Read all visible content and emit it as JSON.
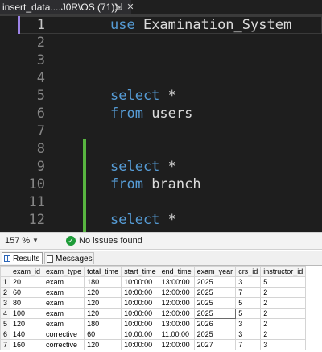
{
  "tab": {
    "title": "insert_data....J0R\\OS (71))",
    "pin_glyph": "⇲",
    "close_glyph": "✕"
  },
  "editor": {
    "lines": [
      {
        "num": "1",
        "keyword": "use",
        "rest": " Examination_System"
      },
      {
        "num": "2",
        "keyword": "",
        "rest": ""
      },
      {
        "num": "3",
        "keyword": "",
        "rest": ""
      },
      {
        "num": "4",
        "keyword": "",
        "rest": ""
      },
      {
        "num": "5",
        "keyword": "select",
        "rest": " *"
      },
      {
        "num": "6",
        "keyword": "from",
        "rest": " users"
      },
      {
        "num": "7",
        "keyword": "",
        "rest": ""
      },
      {
        "num": "8",
        "keyword": "",
        "rest": ""
      },
      {
        "num": "9",
        "keyword": "select",
        "rest": " *"
      },
      {
        "num": "10",
        "keyword": "from",
        "rest": " branch"
      },
      {
        "num": "11",
        "keyword": "",
        "rest": ""
      },
      {
        "num": "12",
        "keyword": "select",
        "rest": " *"
      }
    ]
  },
  "status": {
    "zoom": "157 %",
    "zoom_caret": "▼",
    "ok_glyph": "✓",
    "issues": "No issues found"
  },
  "results_tabs": {
    "results": "Results",
    "messages": "Messages"
  },
  "grid": {
    "columns": [
      "exam_id",
      "exam_type",
      "total_time",
      "start_time",
      "end_time",
      "exam_year",
      "crs_id",
      "instructor_id"
    ],
    "rows": [
      [
        "1",
        "20",
        "exam",
        "180",
        "10:00:00",
        "13:00:00",
        "2025",
        "3",
        "5"
      ],
      [
        "2",
        "60",
        "exam",
        "120",
        "10:00:00",
        "12:00:00",
        "2025",
        "7",
        "2"
      ],
      [
        "3",
        "80",
        "exam",
        "120",
        "10:00:00",
        "12:00:00",
        "2025",
        "5",
        "2"
      ],
      [
        "4",
        "100",
        "exam",
        "120",
        "10:00:00",
        "12:00:00",
        "2025",
        "5",
        "2"
      ],
      [
        "5",
        "120",
        "exam",
        "180",
        "10:00:00",
        "13:00:00",
        "2026",
        "3",
        "2"
      ],
      [
        "6",
        "140",
        "corrective",
        "60",
        "10:00:00",
        "11:00:00",
        "2025",
        "3",
        "2"
      ],
      [
        "7",
        "160",
        "corrective",
        "120",
        "10:00:00",
        "12:00:00",
        "2027",
        "7",
        "3"
      ]
    ],
    "selected_row": 3,
    "selected_col": 6
  }
}
